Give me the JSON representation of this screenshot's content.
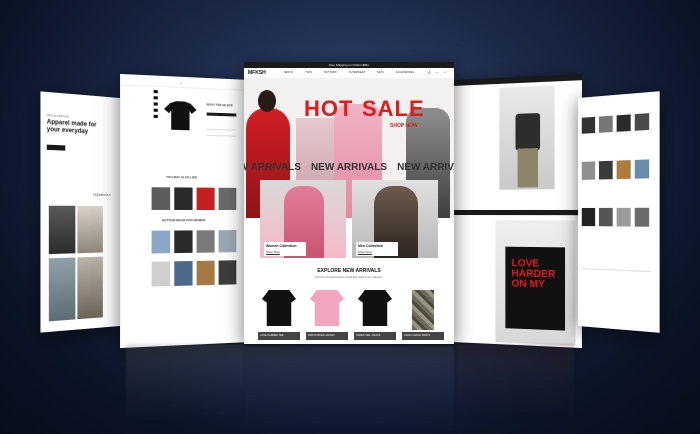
{
  "center_panel": {
    "top_banner": "Free Shipping on Orders $89+",
    "logo": "MFKSH",
    "nav_items": [
      "NEW IN",
      "TOPS",
      "BOTTOMS",
      "OUTERWEAR",
      "SETS",
      "ACCESSORIES"
    ],
    "hero_text_left": "HOT",
    "hero_text_right": "SALE",
    "hero_subtext": "SHOP NOW",
    "marquee": [
      "NEW ARRIVALS",
      "NEW ARRIVALS",
      "NEW ARRIVALS"
    ],
    "collections": [
      {
        "title": "Women Collection",
        "cta": "Shop Now"
      },
      {
        "title": "Men Collection",
        "cta": "Shop Now"
      }
    ],
    "explore_title": "EXPLORE NEW ARRIVALS",
    "explore_sub": "Discover the latest fashion trends and styles in our collection.",
    "products": [
      {
        "name": "LOVE HARDER TEE"
      },
      {
        "name": "PINK PUFFER JACKET"
      },
      {
        "name": "HADES TEE - BLACK"
      },
      {
        "name": "CAMO CARGO PANTS"
      }
    ]
  },
  "second_panel": {
    "product_title": "BOXY TEE BLACK",
    "section_title": "YOU MAY ALSO LIKE",
    "section_title_2": "BOTTOM WEAR FOR WOMEN"
  },
  "left_panel": {
    "tag": "MFKSH BRAND",
    "headline": "Apparel made for your everyday",
    "section": "FEEDBACKS"
  },
  "accent_colors": {
    "primary": "#111111",
    "sale": "#e01b1b",
    "bg_dark": "#0c1428"
  }
}
